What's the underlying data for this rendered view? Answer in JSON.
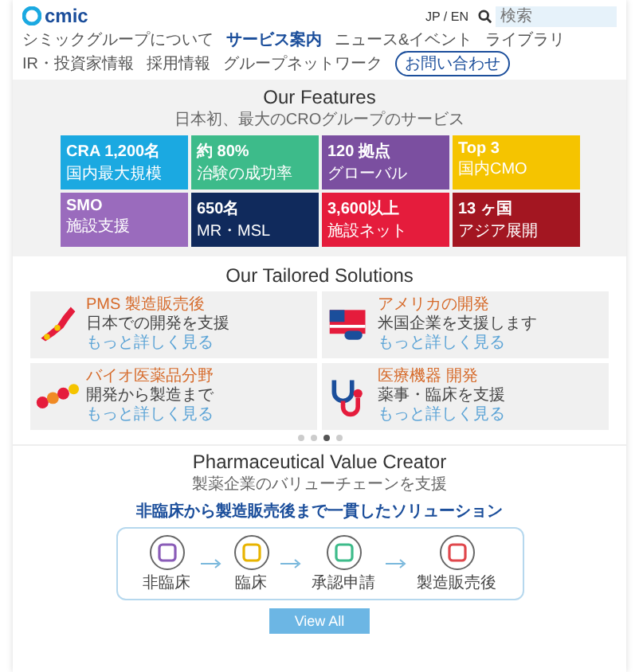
{
  "header": {
    "logo": "cmic",
    "lang": "JP / EN",
    "search_placeholder": "検索"
  },
  "nav": [
    {
      "label": "シミックグループについて",
      "selected": false
    },
    {
      "label": "サービス案内",
      "selected": true
    },
    {
      "label": "ニュース&イベント",
      "selected": false
    },
    {
      "label": "ライブラリ",
      "selected": false
    },
    {
      "label": "IR・投資家情報",
      "selected": false
    },
    {
      "label": "採用情報",
      "selected": false
    },
    {
      "label": "グループネットワーク",
      "selected": false
    }
  ],
  "contact_button": "お問い合わせ",
  "features": {
    "title": "Our Features",
    "subtitle": "日本初、最大のCROグループのサービス",
    "tiles": [
      {
        "value": "CRA 1,200名",
        "label": "国内最大規模",
        "color": "#1ba9e1"
      },
      {
        "value": "約 80%",
        "label": "治験の成功率",
        "color": "#3dbb8a"
      },
      {
        "value": "120 拠点",
        "label": "グローバル",
        "color": "#7b4fa0"
      },
      {
        "value": "Top 3",
        "label": "国内CMO",
        "color": "#f5c400"
      },
      {
        "value": "SMO",
        "label": "施設支援",
        "color": "#9a6bbd"
      },
      {
        "value": "650名",
        "label": "MR・MSL",
        "color": "#102a5c"
      },
      {
        "value": "3,600以上",
        "label": "施設ネット",
        "color": "#e51c3c"
      },
      {
        "value": "13 ヶ国",
        "label": "アジア展開",
        "color": "#a31621"
      }
    ]
  },
  "solutions": {
    "title": "Our Tailored Solutions",
    "cards": [
      {
        "kind": "map",
        "title": "PMS 製造販売後",
        "text": "日本での開発を支援",
        "link": "もっと詳しく見る"
      },
      {
        "kind": "flag",
        "title": "アメリカの開発",
        "text": "米国企業を支援します",
        "link": "もっと詳しく見る"
      },
      {
        "kind": "dots",
        "title": "バイオ医薬品分野",
        "text": "開発から製造まで",
        "link": "もっと詳しく見る"
      },
      {
        "kind": "stethoscope",
        "title": "医療機器 開発",
        "text": "薬事・臨床を支援",
        "link": "もっと詳しく見る"
      }
    ],
    "dots": [
      {
        "selected": false
      },
      {
        "selected": false
      },
      {
        "selected": true
      },
      {
        "selected": false
      }
    ]
  },
  "pharma": {
    "title": "Pharmaceutical Value Creator",
    "subtitle": "製薬企業のバリューチェーンを支援",
    "highlight": "非臨床から製造販売後まで一貫したソリューション",
    "steps": [
      {
        "label": "非臨床",
        "color": "#8a5cb8"
      },
      {
        "label": "臨床",
        "color": "#e8b400"
      },
      {
        "label": "承認申請",
        "color": "#3dbb8a"
      },
      {
        "label": "製造販売後",
        "color": "#e0474c"
      }
    ],
    "button": "View All"
  }
}
